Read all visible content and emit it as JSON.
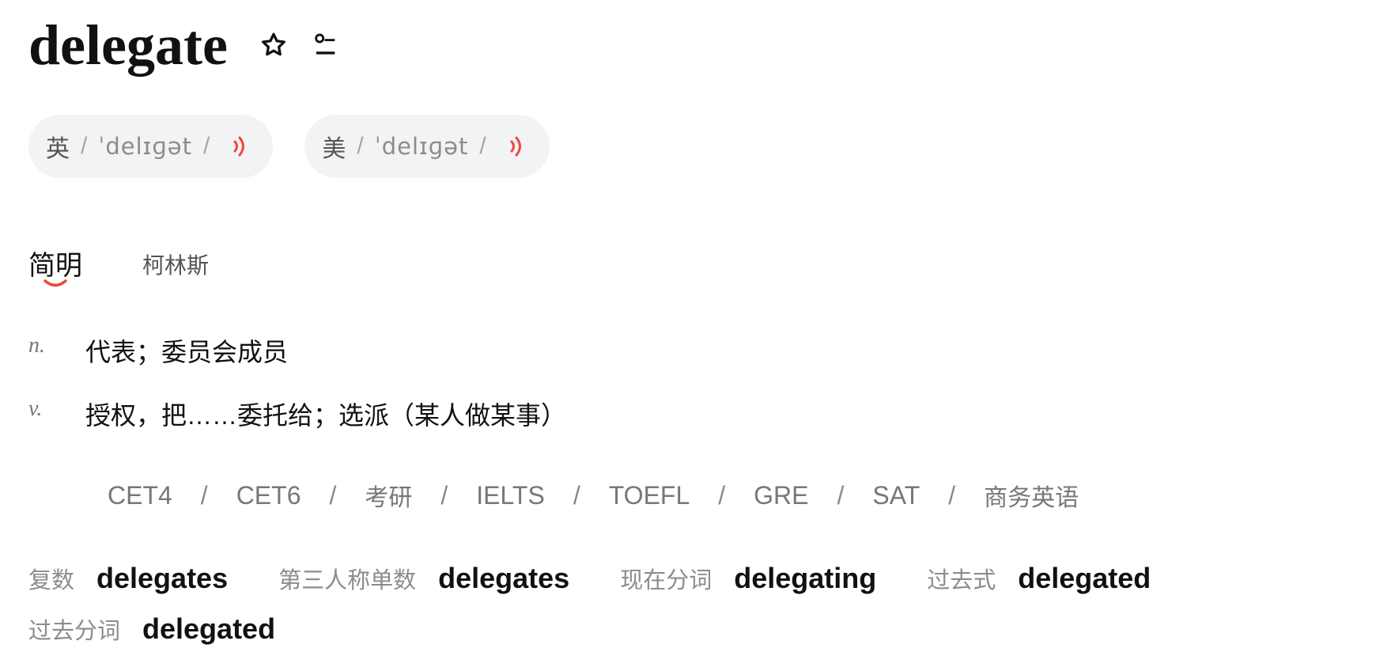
{
  "header": {
    "word": "delegate",
    "favorite_icon": "star-icon",
    "wordbook_icon": "add-to-wordbook-icon"
  },
  "pronunciations": [
    {
      "region": "英",
      "sep_left": "/",
      "ipa": "ˈdelɪɡət",
      "sep_right": "/",
      "icon": "speaker-icon"
    },
    {
      "region": "美",
      "sep_left": "/",
      "ipa": "ˈdelɪɡət",
      "sep_right": "/",
      "icon": "speaker-icon"
    }
  ],
  "tabs": [
    {
      "label": "简明",
      "active": true
    },
    {
      "label": "柯林斯",
      "active": false
    }
  ],
  "definitions": [
    {
      "pos": "n.",
      "meaning": "代表；委员会成员"
    },
    {
      "pos": "v.",
      "meaning": "授权，把……委托给；选派（某人做某事）"
    }
  ],
  "exams": [
    "CET4",
    "CET6",
    "考研",
    "IELTS",
    "TOEFL",
    "GRE",
    "SAT",
    "商务英语"
  ],
  "exam_separator": "/",
  "word_forms": [
    {
      "label": "复数",
      "value": "delegates"
    },
    {
      "label": "第三人称单数",
      "value": "delegates"
    },
    {
      "label": "现在分词",
      "value": "delegating"
    },
    {
      "label": "过去式",
      "value": "delegated"
    },
    {
      "label": "过去分词",
      "value": "delegated"
    }
  ],
  "colors": {
    "accent": "#f0463c",
    "pill_bg": "#f2f3f5",
    "muted": "#8c8c8c"
  }
}
